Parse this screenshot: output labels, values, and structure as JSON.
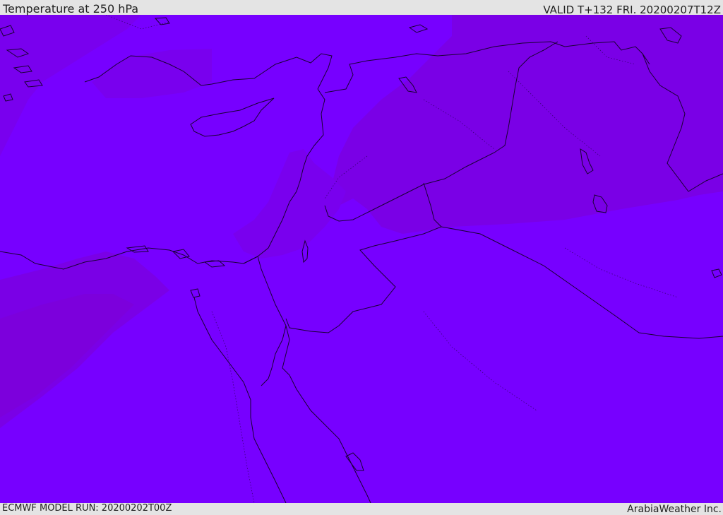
{
  "header": {
    "title": "Temperature at 250 hPa",
    "valid": "VALID T+132 FRI. 20200207T12Z"
  },
  "footer": {
    "model_run": "ECMWF MODEL RUN: 20200202T00Z",
    "credit": "ArabiaWeather Inc."
  },
  "colors": {
    "base_fill": "#7700ff",
    "darker_band": "#7a00e8",
    "darkest_band": "#7c00dc",
    "border_line": "#1a0033"
  }
}
